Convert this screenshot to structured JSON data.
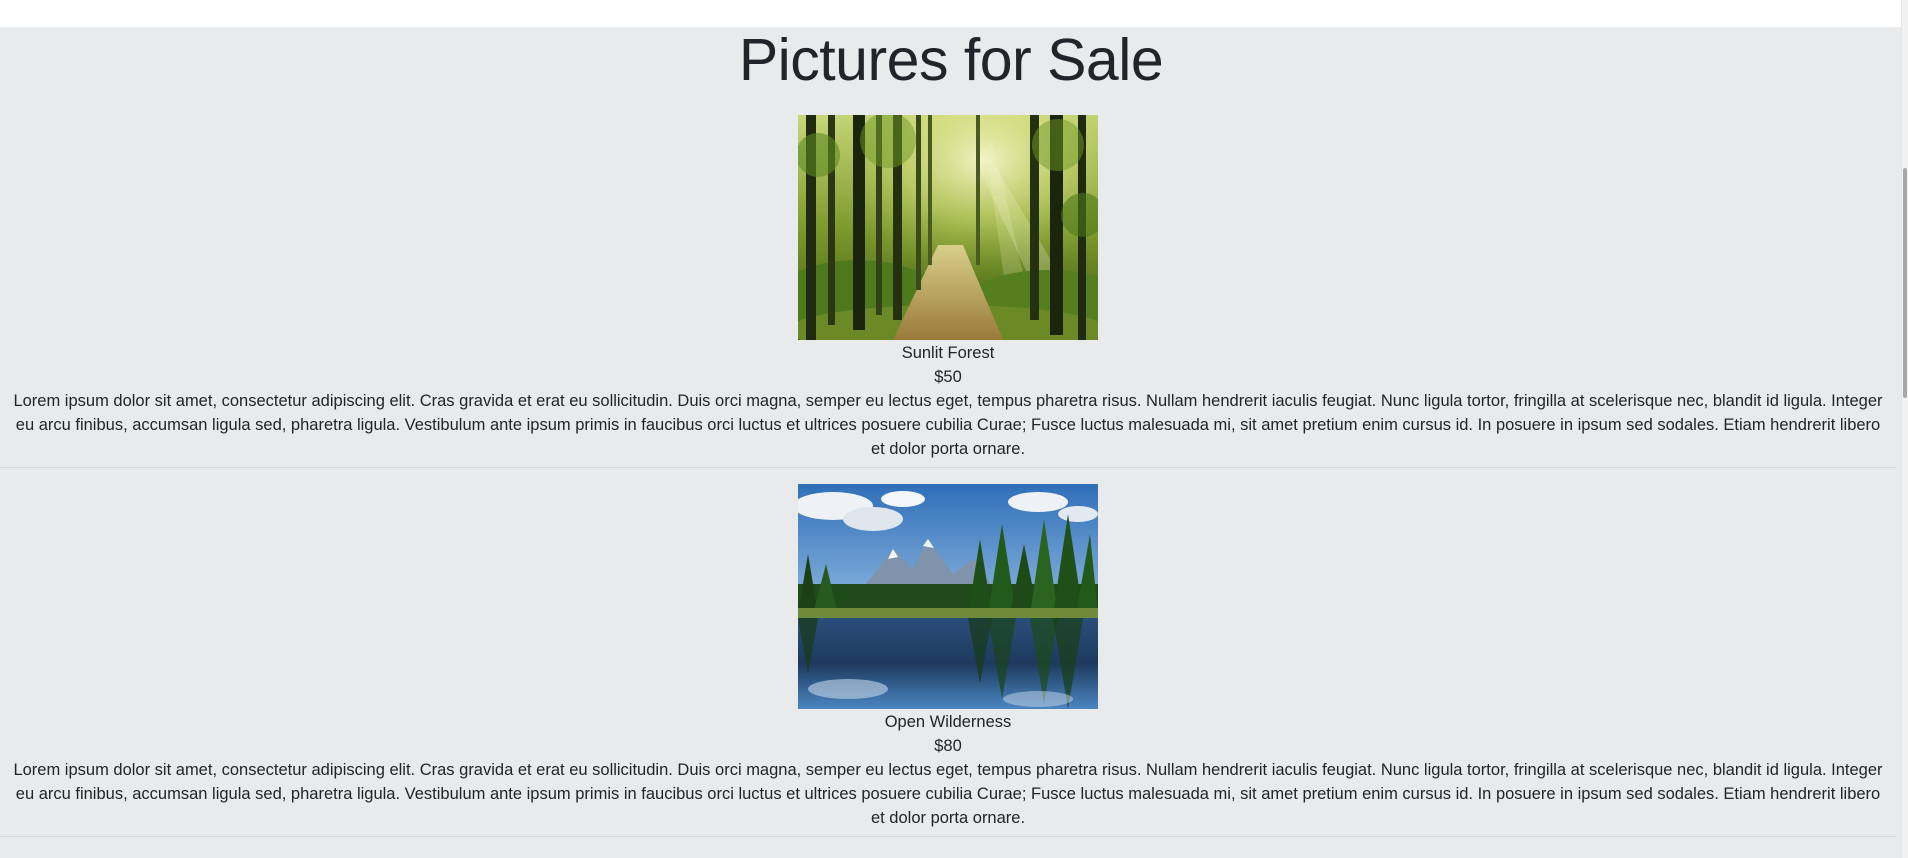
{
  "page": {
    "title": "Pictures for Sale"
  },
  "products": [
    {
      "name": "Sunlit Forest",
      "price": "$50",
      "description": "Lorem ipsum dolor sit amet, consectetur adipiscing elit. Cras gravida et erat eu sollicitudin. Duis orci magna, semper eu lectus eget, tempus pharetra risus. Nullam hendrerit iaculis feugiat. Nunc ligula tortor, fringilla at scelerisque nec, blandit id ligula. Integer eu arcu finibus, accumsan ligula sed, pharetra ligula. Vestibulum ante ipsum primis in faucibus orci luctus et ultrices posuere cubilia Curae; Fusce luctus malesuada mi, sit amet pretium enim cursus id. In posuere in ipsum sed sodales. Etiam hendrerit libero et dolor porta ornare."
    },
    {
      "name": "Open Wilderness",
      "price": "$80",
      "description": "Lorem ipsum dolor sit amet, consectetur adipiscing elit. Cras gravida et erat eu sollicitudin. Duis orci magna, semper eu lectus eget, tempus pharetra risus. Nullam hendrerit iaculis feugiat. Nunc ligula tortor, fringilla at scelerisque nec, blandit id ligula. Integer eu arcu finibus, accumsan ligula sed, pharetra ligula. Vestibulum ante ipsum primis in faucibus orci luctus et ultrices posuere cubilia Curae; Fusce luctus malesuada mi, sit amet pretium enim cursus id. In posuere in ipsum sed sodales. Etiam hendrerit libero et dolor porta ornare."
    }
  ],
  "colors": {
    "background": "#e9eaec",
    "text": "#212529",
    "divider": "#cfd2d6"
  }
}
